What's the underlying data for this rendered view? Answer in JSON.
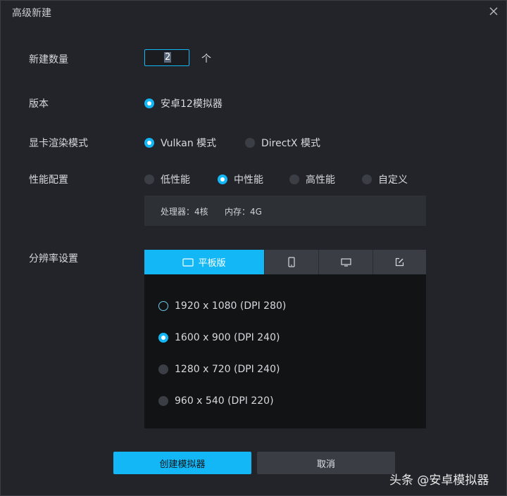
{
  "window": {
    "title": "高级新建"
  },
  "count": {
    "label": "新建数量",
    "value": "2",
    "unit": "个"
  },
  "version": {
    "label": "版本",
    "options": [
      {
        "label": "安卓12模拟器",
        "selected": true
      }
    ]
  },
  "render_mode": {
    "label": "显卡渲染模式",
    "options": [
      {
        "label": "Vulkan 模式",
        "selected": true
      },
      {
        "label": "DirectX 模式",
        "selected": false
      }
    ]
  },
  "performance": {
    "label": "性能配置",
    "options": [
      {
        "label": "低性能",
        "selected": false
      },
      {
        "label": "中性能",
        "selected": true
      },
      {
        "label": "高性能",
        "selected": false
      },
      {
        "label": "自定义",
        "selected": false
      }
    ],
    "cpu_text": "处理器：4核",
    "memory_text": "内存：4G"
  },
  "resolution": {
    "label": "分辨率设置",
    "tabs": [
      {
        "label": "平板版",
        "icon": "tablet-icon",
        "active": true
      },
      {
        "label": "",
        "icon": "phone-icon",
        "active": false
      },
      {
        "label": "",
        "icon": "monitor-icon",
        "active": false
      },
      {
        "label": "",
        "icon": "edit-icon",
        "active": false
      }
    ],
    "options": [
      {
        "label": "1920 x 1080 (DPI 280)",
        "state": "hover"
      },
      {
        "label": "1600 x 900 (DPI 240)",
        "state": "selected"
      },
      {
        "label": "1280 x 720 (DPI 240)",
        "state": "unselected"
      },
      {
        "label": "960 x 540 (DPI 220)",
        "state": "unselected"
      }
    ]
  },
  "buttons": {
    "create": "创建模拟器",
    "cancel": "取消"
  },
  "watermark": "头条 @安卓模拟器",
  "colors": {
    "accent": "#13b7f5",
    "background": "#222429",
    "panel": "#121315"
  }
}
